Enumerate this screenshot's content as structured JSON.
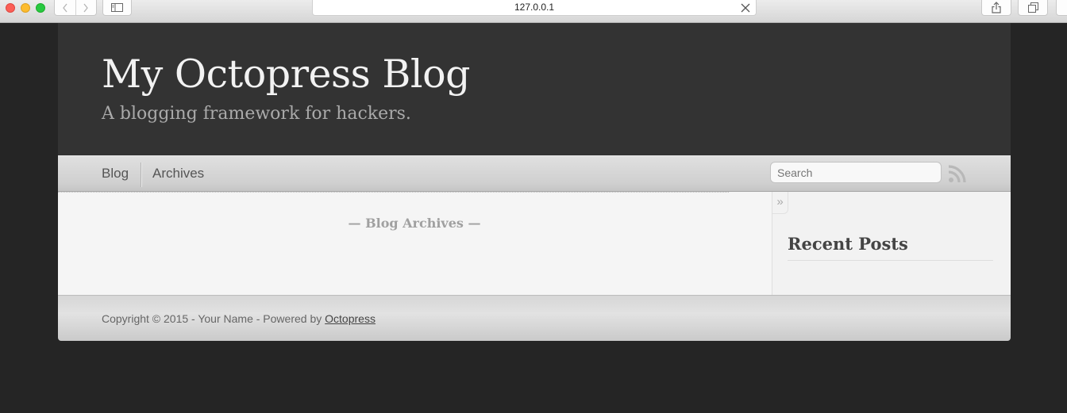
{
  "browser": {
    "url": "127.0.0.1",
    "icons": {
      "back": "chevron-left-icon",
      "forward": "chevron-right-icon",
      "sidebar": "sidebar-icon",
      "close": "close-icon",
      "share": "share-icon",
      "tabs": "tabs-icon"
    }
  },
  "header": {
    "title": "My Octopress Blog",
    "subtitle": "A blogging framework for hackers."
  },
  "nav": {
    "items": [
      {
        "label": "Blog"
      },
      {
        "label": "Archives"
      }
    ],
    "search_placeholder": "Search",
    "rss_icon": "rss-icon"
  },
  "main": {
    "heading": "— Blog Archives —"
  },
  "sidebar": {
    "toggle": "»",
    "recent_posts_title": "Recent Posts"
  },
  "footer": {
    "text": "Copyright © 2015 - Your Name - Powered by ",
    "link_label": "Octopress"
  },
  "colors": {
    "page_background": "#252525",
    "header_background": "#333333",
    "title_color": "#f2f2f2",
    "subtitle_color": "#aaaaaa"
  }
}
